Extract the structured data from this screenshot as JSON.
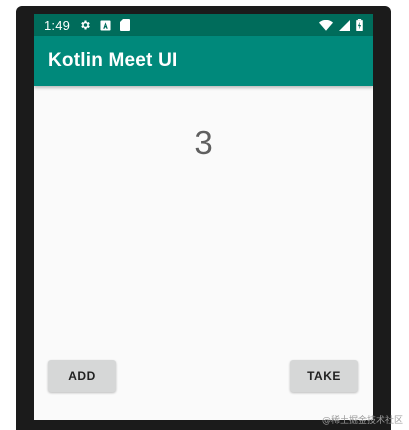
{
  "status_bar": {
    "time": "1:49",
    "icons": [
      "gear-icon",
      "a-badge-icon",
      "sd-card-icon",
      "wifi-icon",
      "signal-icon",
      "battery-icon"
    ]
  },
  "app_bar": {
    "title": "Kotlin Meet UI"
  },
  "counter": {
    "value": "3"
  },
  "buttons": {
    "add_label": "ADD",
    "take_label": "TAKE"
  },
  "watermark": {
    "text": "@稀土掘金技术社区"
  },
  "colors": {
    "status_bar": "#006c5b",
    "app_bar": "#00897b",
    "button": "#d6d7d7",
    "counter_text": "#5f5f5f"
  }
}
